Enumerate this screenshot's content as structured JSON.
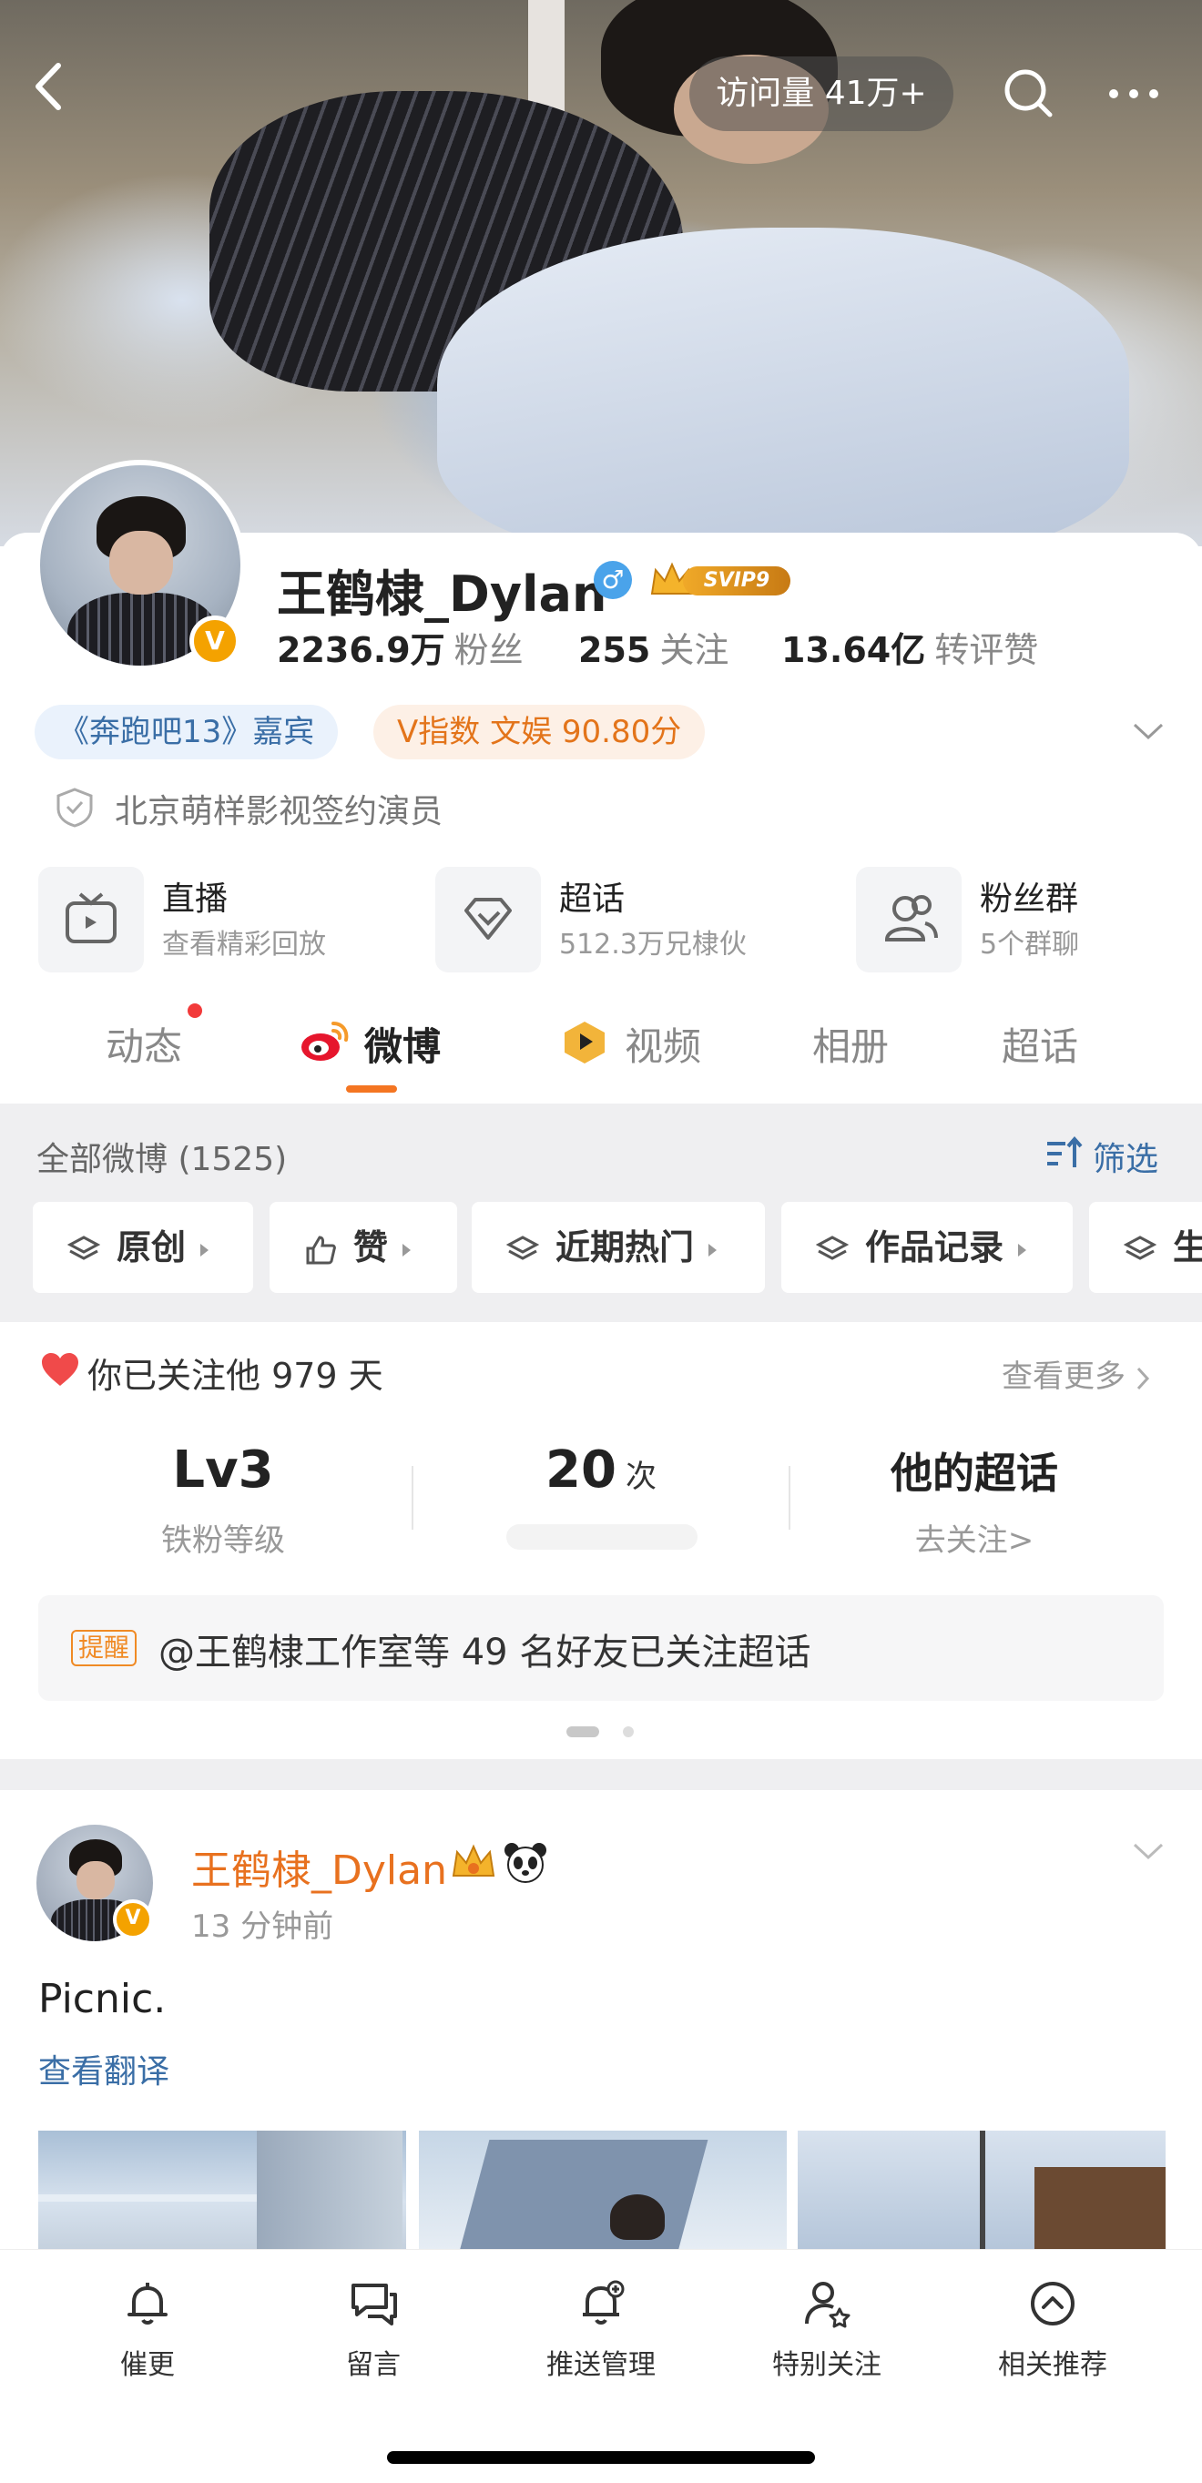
{
  "header": {
    "visit_label": "访问量 41万+"
  },
  "profile": {
    "name": "王鹤棣_Dylan",
    "verified_badge": "V",
    "svip_label": "SVIP9",
    "stats": [
      {
        "value": "2236.9万",
        "label": "粉丝"
      },
      {
        "value": "255",
        "label": "关注"
      },
      {
        "value": "13.64亿",
        "label": "转评赞"
      }
    ],
    "tags": [
      "《奔跑吧13》嘉宾",
      "V指数 文娱 90.80分"
    ],
    "verification": "北京萌样影视签约演员"
  },
  "services": [
    {
      "title": "直播",
      "subtitle": "查看精彩回放",
      "icon": "tv-icon"
    },
    {
      "title": "超话",
      "subtitle": "512.3万兄棣伙",
      "icon": "diamond-icon"
    },
    {
      "title": "粉丝群",
      "subtitle": "5个群聊",
      "icon": "group-icon"
    }
  ],
  "tabs": [
    {
      "label": "动态",
      "active": false
    },
    {
      "label": "微博",
      "active": true
    },
    {
      "label": "视频",
      "active": false
    },
    {
      "label": "相册",
      "active": false
    },
    {
      "label": "超话",
      "active": false
    }
  ],
  "feed_filter": {
    "all_label": "全部微博 (1525)",
    "filter_label": "筛选",
    "chips": [
      "原创",
      "赞",
      "近期热门",
      "作品记录",
      "生"
    ]
  },
  "fan_panel": {
    "follow_days": "你已关注他 979 天",
    "see_more": "查看更多",
    "level": {
      "value": "Lv3",
      "label": "铁粉等级"
    },
    "count": {
      "value": "20",
      "unit": "次"
    },
    "supertopic": {
      "value": "他的超话",
      "label": "去关注>"
    },
    "remind_tag": "提醒",
    "remind_text": "@王鹤棣工作室等 49 名好友已关注超话"
  },
  "post": {
    "author": "王鹤棣_Dylan",
    "time": "13 分钟前",
    "text": "Picnic.",
    "translate": "查看翻译"
  },
  "bottom_bar": [
    {
      "label": "催更",
      "icon": "bell-icon"
    },
    {
      "label": "留言",
      "icon": "chat-icon"
    },
    {
      "label": "推送管理",
      "icon": "bell-plus-icon"
    },
    {
      "label": "特别关注",
      "icon": "user-star-icon"
    },
    {
      "label": "相关推荐",
      "icon": "chevron-circle-icon"
    }
  ],
  "colors": {
    "accent": "#f47522",
    "link": "#3a6ea6",
    "name_orange": "#e8711f",
    "vip_gold": "#f4a200"
  }
}
